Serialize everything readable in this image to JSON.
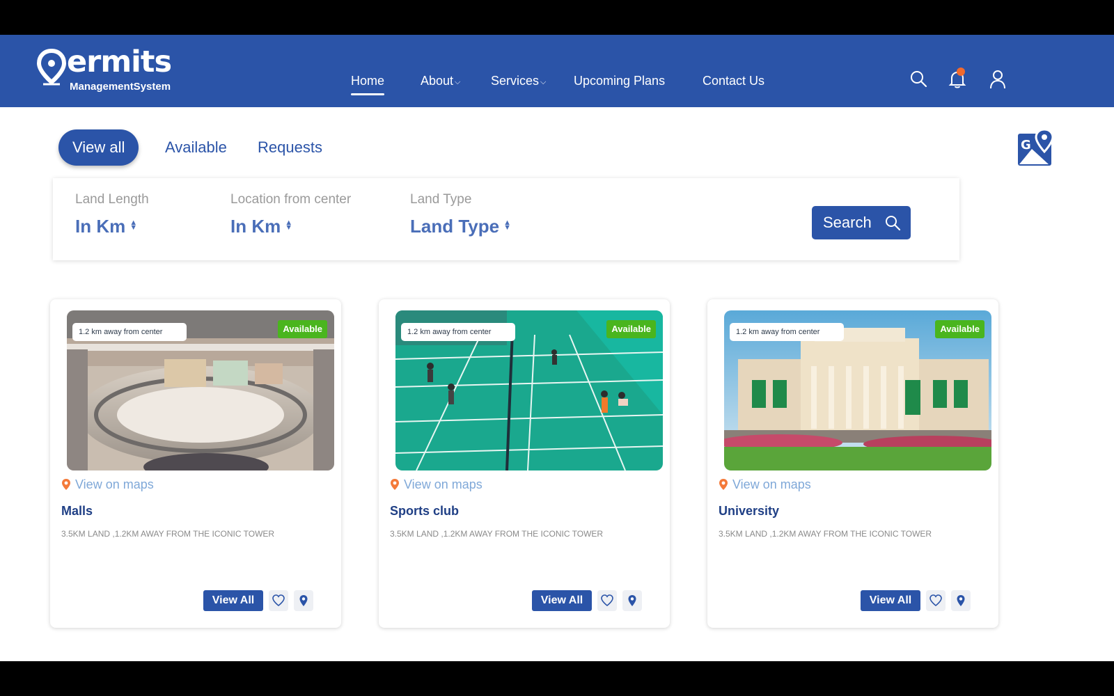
{
  "header": {
    "logo_text": "ermits",
    "logo_subtitle": "ManagementSystem",
    "nav": [
      {
        "label": "Home",
        "active": true
      },
      {
        "label": "About",
        "dropdown": true
      },
      {
        "label": "Services",
        "dropdown": true
      },
      {
        "label": "Upcoming Plans"
      },
      {
        "label": "Contact Us"
      }
    ],
    "icons": [
      "search-icon",
      "bell-icon",
      "user-icon"
    ]
  },
  "tabs": [
    {
      "label": "View all",
      "active": true
    },
    {
      "label": "Available"
    },
    {
      "label": "Requests"
    }
  ],
  "filters": [
    {
      "label": "Land Length",
      "value": "In Km"
    },
    {
      "label": "Location from center",
      "value": "In Km"
    },
    {
      "label": "Land Type",
      "value": "Land Type"
    }
  ],
  "search_label": "Search",
  "cards": [
    {
      "title": "Malls",
      "distance_badge": "1.2 km away from center",
      "status": "Available",
      "maps_link": "View on maps",
      "description": "3.5KM LAND ,1.2KM AWAY FROM THE ICONIC TOWER",
      "button": "View All"
    },
    {
      "title": "Sports club",
      "distance_badge": "1.2 km away from center",
      "status": "Available",
      "maps_link": "View on maps",
      "description": "3.5KM LAND ,1.2KM AWAY FROM THE ICONIC TOWER",
      "button": "View All"
    },
    {
      "title": "University",
      "distance_badge": "1.2 km away from center",
      "status": "Available",
      "maps_link": "View on maps",
      "description": "3.5KM LAND ,1.2KM AWAY FROM THE ICONIC TOWER",
      "button": "View All"
    }
  ],
  "colors": {
    "primary": "#2b54a8",
    "available": "#4ab51e",
    "accent": "#f26a2e",
    "link": "#7fa8d8"
  }
}
